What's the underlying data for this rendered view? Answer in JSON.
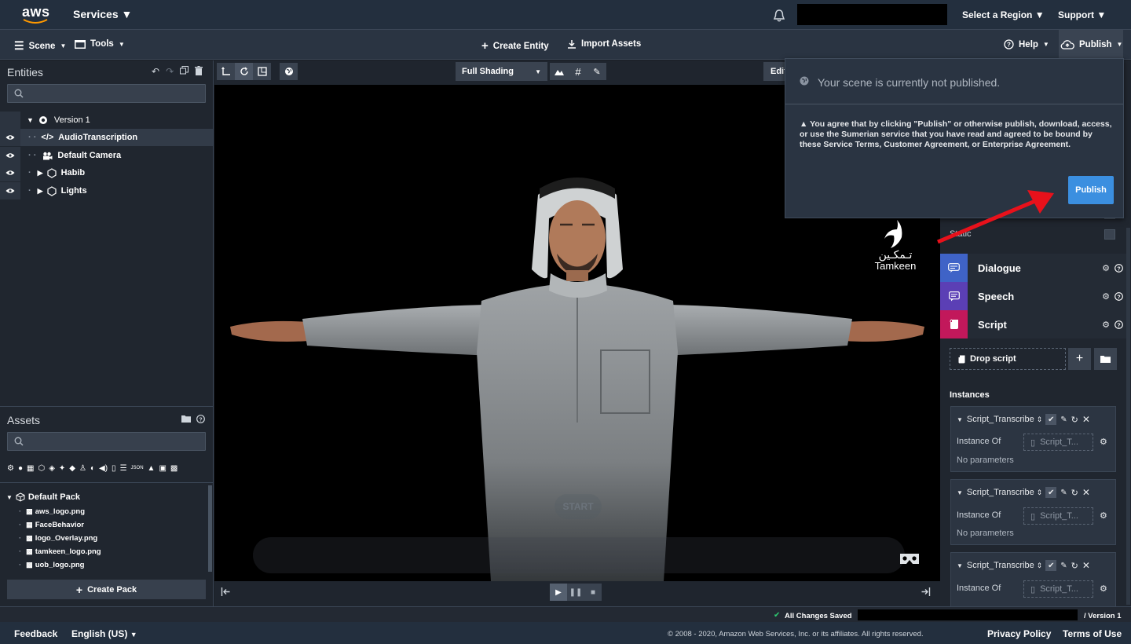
{
  "topbar": {
    "logo": "aws",
    "services": "Services",
    "region": "Select a Region",
    "support": "Support"
  },
  "toolbar": {
    "scene": "Scene",
    "tools": "Tools",
    "create_entity": "Create Entity",
    "import_assets": "Import Assets",
    "help": "Help",
    "publish": "Publish"
  },
  "entities": {
    "title": "Entities",
    "search_placeholder": "",
    "root": "Version 1",
    "items": [
      {
        "label": "AudioTranscription",
        "icon": "code-icon"
      },
      {
        "label": "Default Camera",
        "icon": "camera-icon"
      },
      {
        "label": "Habib",
        "icon": "hexagon-icon"
      },
      {
        "label": "Lights",
        "icon": "hexagon-icon"
      }
    ]
  },
  "assets": {
    "title": "Assets",
    "pack": "Default Pack",
    "items": [
      "aws_logo.png",
      "FaceBehavior",
      "logo_Overlay.png",
      "tamkeen_logo.png",
      "uob_logo.png"
    ],
    "create_pack": "Create Pack"
  },
  "viewport": {
    "shading": "Full Shading",
    "edit": "Edit",
    "logo_text": "Tamkeen",
    "logo_arabic": "تـمكـين",
    "start": "START"
  },
  "popover": {
    "title": "Your scene is currently not published.",
    "body": "You agree that by clicking \"Publish\" or otherwise publish, download, access, or use the Sumerian service that you have read and agreed to be bound by these Service Terms, Customer Agreement, or Enterprise Agreement.",
    "button": "Publish"
  },
  "inspector": {
    "static_label": "Static",
    "components": [
      {
        "label": "Dialogue",
        "color": "#3f63c7"
      },
      {
        "label": "Speech",
        "color": "#5b3fb5"
      },
      {
        "label": "Script",
        "color": "#c2185b"
      }
    ],
    "drop_script": "Drop script",
    "instances_title": "Instances",
    "instances": [
      {
        "name": "Script_Transcribe",
        "instance_of_label": "Instance Of",
        "instance_of_value": "Script_T...",
        "params": "No parameters"
      },
      {
        "name": "Script_Transcribe",
        "instance_of_label": "Instance Of",
        "instance_of_value": "Script_T...",
        "params": "No parameters"
      },
      {
        "name": "Script_Transcribe",
        "instance_of_label": "Instance Of",
        "instance_of_value": "Script_T...",
        "params": ""
      }
    ]
  },
  "status": {
    "saved": "All Changes Saved",
    "version": "/  Version 1"
  },
  "footer": {
    "feedback": "Feedback",
    "language": "English (US)",
    "copyright": "© 2008 - 2020, Amazon Web Services, Inc. or its affiliates. All rights reserved.",
    "privacy": "Privacy Policy",
    "terms": "Terms of Use"
  },
  "colors": {
    "accent": "#3b8fe0",
    "arrow": "#e8111b",
    "saved_check": "#2ecc71"
  }
}
